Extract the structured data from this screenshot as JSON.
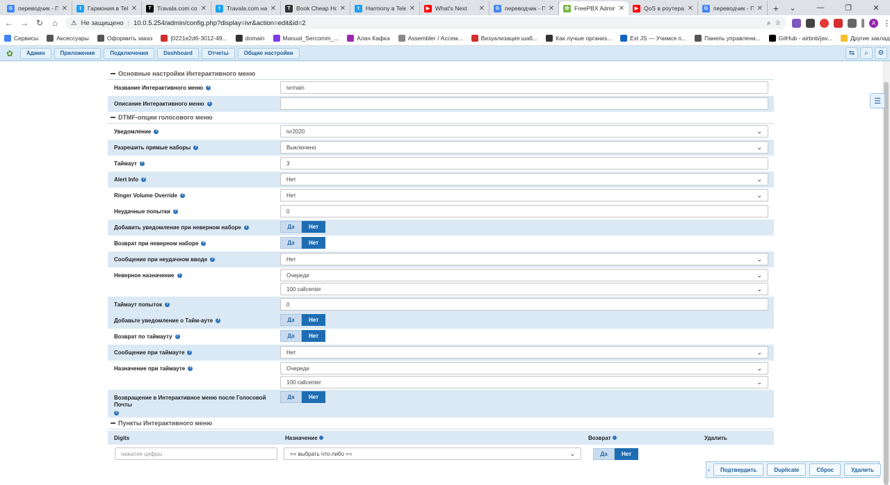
{
  "browser": {
    "tabs": [
      {
        "title": "переводчик - Пои",
        "color": "#4285f4",
        "glyph": "G"
      },
      {
        "title": "Гармония в Telegr",
        "color": "#1da1f2",
        "glyph": "t"
      },
      {
        "title": "Travala.com com",
        "color": "#000000",
        "glyph": "T"
      },
      {
        "title": "Travala.com на",
        "color": "#1da1f2",
        "glyph": "t"
      },
      {
        "title": "Book Cheap Hotel",
        "color": "#333333",
        "glyph": "T"
      },
      {
        "title": "Harmony в Telegr",
        "color": "#1da1f2",
        "glyph": "t"
      },
      {
        "title": "What's Next",
        "color": "#ff0000",
        "glyph": "▶"
      },
      {
        "title": "переводчик - Пои",
        "color": "#4285f4",
        "glyph": "G"
      },
      {
        "title": "FreePBX Admin",
        "color": "#7ab648",
        "glyph": "✿"
      },
      {
        "title": "QoS в роутерах",
        "color": "#ff0000",
        "glyph": "▶"
      },
      {
        "title": "переводчик - Пои",
        "color": "#4285f4",
        "glyph": "G"
      }
    ],
    "active_tab": 8,
    "security_label": "Не защищено",
    "url": "10.0.5.254/admin/config.php?display=ivr&action=edit&id=2",
    "bookmarks": [
      {
        "label": "Сервисы",
        "color": "#4285f4"
      },
      {
        "label": "Аксессуары",
        "color": "#555555"
      },
      {
        "label": "Оформить заказ",
        "color": "#555555"
      },
      {
        "label": "[0221e2d6-3012-49...",
        "color": "#d32f2f"
      },
      {
        "label": "domain",
        "color": "#333333"
      },
      {
        "label": "Manual_Sercomm_...",
        "color": "#7b3fe4"
      },
      {
        "label": "Алач Кафка",
        "color": "#9c27b0"
      },
      {
        "label": "Assembler / Ассем...",
        "color": "#888888"
      },
      {
        "label": "Визуализация шаб...",
        "color": "#d32f2f"
      },
      {
        "label": "Как лучше организ...",
        "color": "#333333"
      },
      {
        "label": "Ext JS — Учимся п...",
        "color": "#1565c0"
      },
      {
        "label": "Панель управлени...",
        "color": "#555555"
      },
      {
        "label": "GitHub - airbnb/jav...",
        "color": "#000000"
      },
      {
        "label": "Другие закладки",
        "color": "#f9c02c"
      }
    ]
  },
  "menu": {
    "items": [
      "Админ",
      "Приложения",
      "Подключения",
      "Dashboard",
      "Отчеты",
      "Общие настройки"
    ]
  },
  "sections": {
    "general_title": "Основные настройки Интерактивного меню",
    "dtmf_title": "DTMF-опции голосового меню",
    "entries_title": "Пункты Интерактивного меню"
  },
  "general": {
    "name_label": "Название Интерактивного меню",
    "name_value": "ivrmain",
    "desc_label": "Описание Интерактивного меню",
    "desc_value": ""
  },
  "dtmf": {
    "announcement_label": "Уведомление",
    "announcement_value": "ivr2020",
    "direct_dial_label": "Разрешить прямые наборы",
    "direct_dial_value": "Выключено",
    "timeout_label": "Таймаут",
    "timeout_value": "3",
    "alert_info_label": "Alert Info",
    "alert_info_value": "Нет",
    "ringer_label": "Ringer Volume Override",
    "ringer_value": "Нет",
    "invalid_retries_label": "Неудачные попытки",
    "invalid_retries_value": "0",
    "append_invalid_label": "Добавить уведомление при неверном наборе",
    "return_invalid_label": "Возврат при неверном наборе",
    "invalid_msg_label": "Сообщение при неудачном вводе",
    "invalid_msg_value": "Нет",
    "invalid_dest_label": "Неверное назначение",
    "invalid_dest_type": "Очереди",
    "invalid_dest_value": "100 callcenter",
    "timeout_retries_label": "Таймаут попыток",
    "timeout_retries_value": "0",
    "append_timeout_label": "Добавьте уведомление о Тайм-ауте",
    "return_timeout_label": "Возврат по таймауту",
    "timeout_msg_label": "Сообщение при таймауте",
    "timeout_msg_value": "Нет",
    "timeout_dest_label": "Назначение при таймауте",
    "timeout_dest_type": "Очереди",
    "timeout_dest_value": "100 callcenter",
    "return_vm_label": "Возвращение в Интерактивное меню после Голосовой Почты",
    "yes": "Да",
    "no": "Нет"
  },
  "entries": {
    "col_digits": "Digits",
    "col_dest": "Назначение",
    "col_return": "Возврат",
    "col_delete": "Удалить",
    "digits_placeholder": "нажатие цифры",
    "dest_placeholder": "== выбрать что-либо =="
  },
  "actions": [
    "Подтвердить",
    "Duplicate",
    "Сброс",
    "Удалить"
  ]
}
